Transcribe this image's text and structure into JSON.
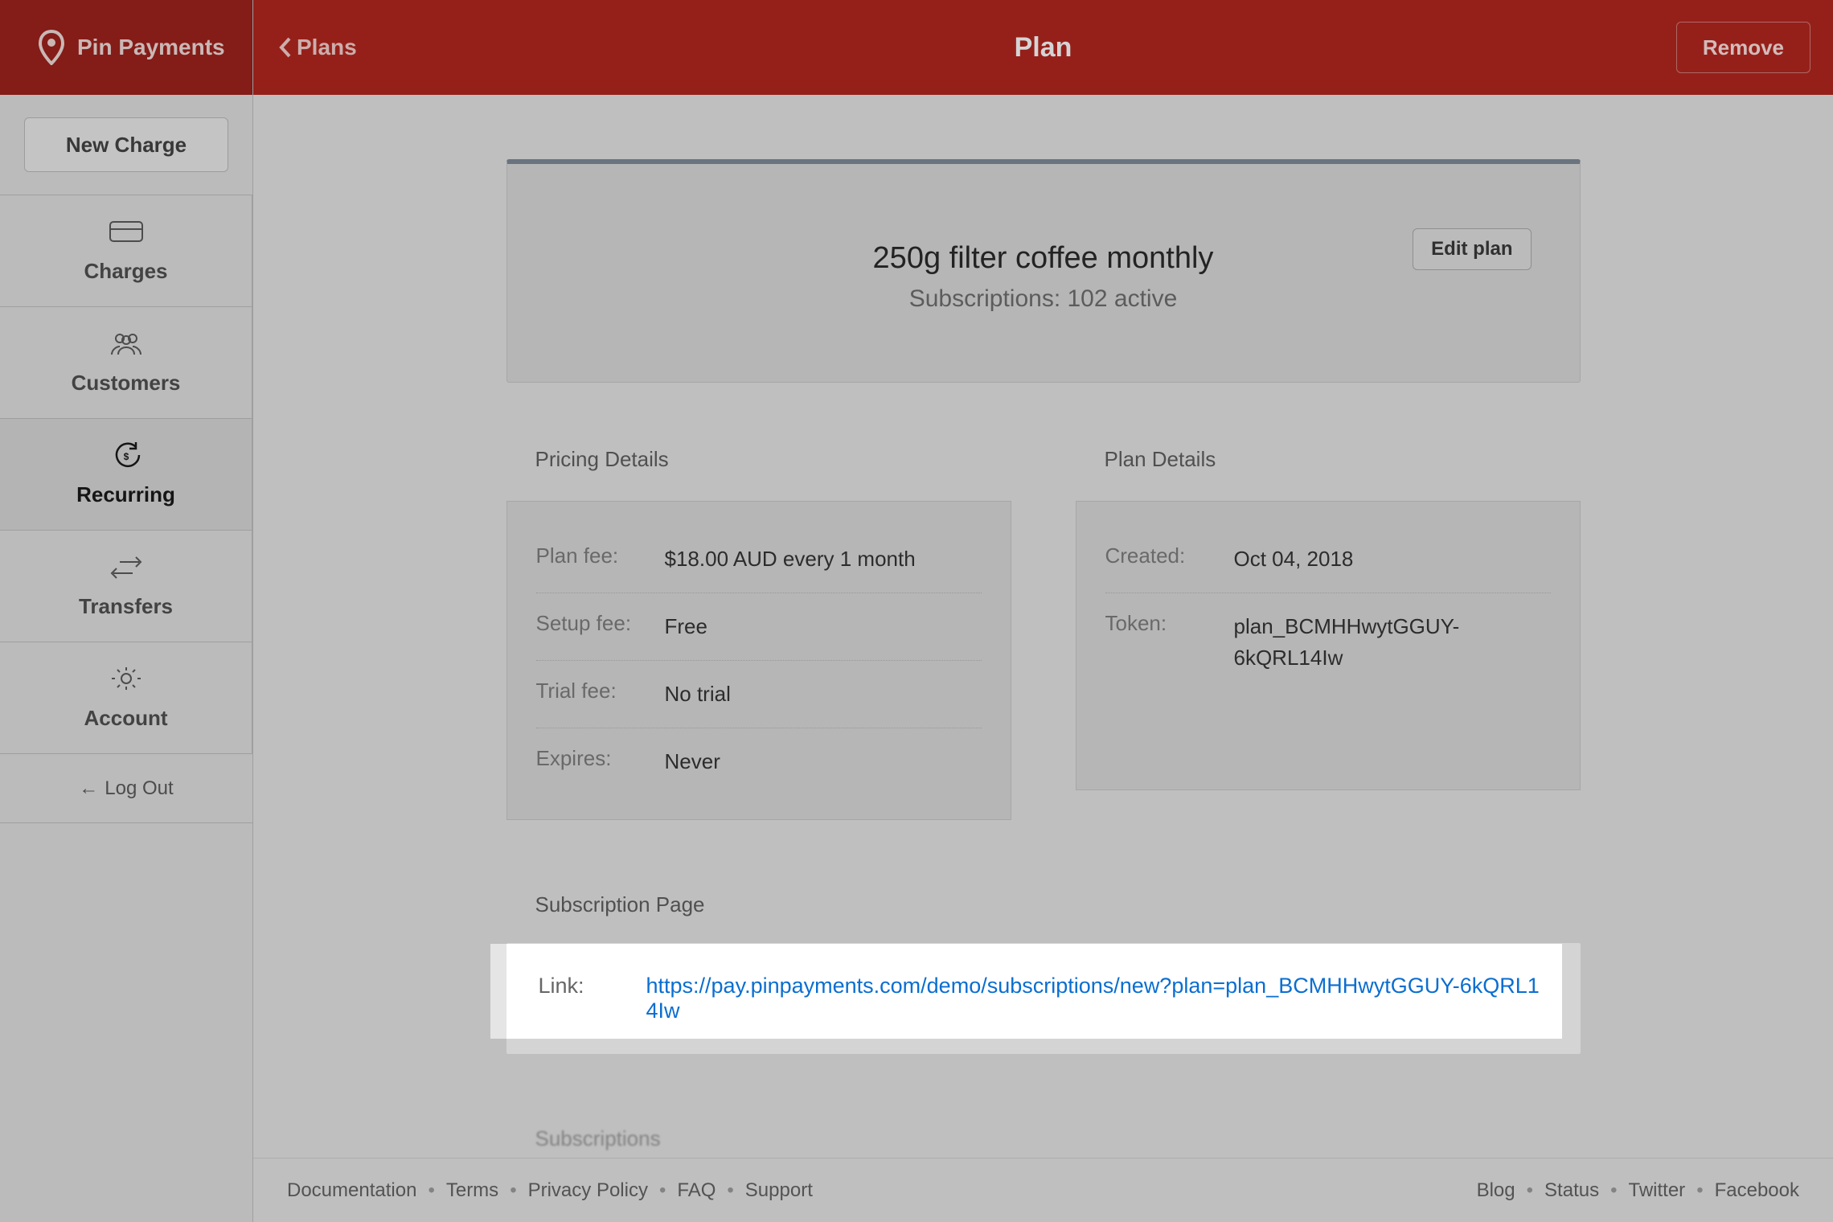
{
  "brand": {
    "name": "Pin Payments"
  },
  "sidebar": {
    "new_charge": "New Charge",
    "items": [
      {
        "label": "Charges"
      },
      {
        "label": "Customers"
      },
      {
        "label": "Recurring"
      },
      {
        "label": "Transfers"
      },
      {
        "label": "Account"
      }
    ],
    "logout": "Log Out"
  },
  "header": {
    "back_label": "Plans",
    "title": "Plan",
    "remove": "Remove"
  },
  "plan_card": {
    "edit": "Edit plan",
    "title": "250g filter coffee monthly",
    "subtitle": "Subscriptions: 102 active"
  },
  "pricing": {
    "title": "Pricing Details",
    "rows": {
      "plan_fee": {
        "k": "Plan fee:",
        "v": "$18.00 AUD every 1 month"
      },
      "setup_fee": {
        "k": "Setup fee:",
        "v": "Free"
      },
      "trial_fee": {
        "k": "Trial fee:",
        "v": "No trial"
      },
      "expires": {
        "k": "Expires:",
        "v": "Never"
      }
    }
  },
  "details": {
    "title": "Plan Details",
    "rows": {
      "created": {
        "k": "Created:",
        "v": "Oct 04, 2018"
      },
      "token": {
        "k": "Token:",
        "v": "plan_BCMHHwytGGUY-6kQRL14Iw"
      }
    }
  },
  "subscription_page": {
    "title": "Subscription Page",
    "link_label": "Link:",
    "link_value": "https://pay.pinpayments.com/demo/subscriptions/new?plan=plan_BCMHHwytGGUY-6kQRL14Iw"
  },
  "subscriptions_section": {
    "title": "Subscriptions"
  },
  "footer": {
    "left": [
      "Documentation",
      "Terms",
      "Privacy Policy",
      "FAQ",
      "Support"
    ],
    "right": [
      "Blog",
      "Status",
      "Twitter",
      "Facebook"
    ]
  }
}
